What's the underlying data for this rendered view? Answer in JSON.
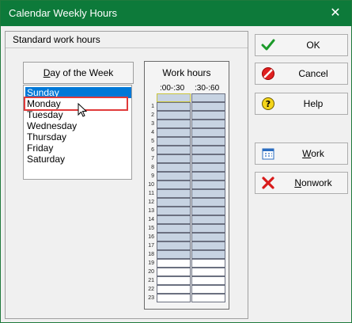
{
  "window": {
    "title": "Calendar Weekly Hours",
    "close_label": "✕"
  },
  "panel": {
    "header": "Standard work hours"
  },
  "days": {
    "header": "Day of the Week",
    "items": [
      "Sunday",
      "Monday",
      "Tuesday",
      "Wednesday",
      "Thursday",
      "Friday",
      "Saturday"
    ],
    "selected": "Sunday",
    "highlighted": "Monday"
  },
  "work_hours": {
    "title": "Work hours",
    "col_a": ":00-:30",
    "col_b": ":30-:60",
    "rows": [
      {
        "hour": "",
        "a": "work",
        "b": "work"
      },
      {
        "hour": "1",
        "a": "work",
        "b": "work"
      },
      {
        "hour": "2",
        "a": "work",
        "b": "work"
      },
      {
        "hour": "3",
        "a": "work",
        "b": "work"
      },
      {
        "hour": "4",
        "a": "work",
        "b": "work"
      },
      {
        "hour": "5",
        "a": "work",
        "b": "work"
      },
      {
        "hour": "6",
        "a": "work",
        "b": "work"
      },
      {
        "hour": "7",
        "a": "work",
        "b": "work"
      },
      {
        "hour": "8",
        "a": "work",
        "b": "work"
      },
      {
        "hour": "9",
        "a": "work",
        "b": "work"
      },
      {
        "hour": "10",
        "a": "work",
        "b": "work"
      },
      {
        "hour": "11",
        "a": "work",
        "b": "work"
      },
      {
        "hour": "12",
        "a": "work",
        "b": "work"
      },
      {
        "hour": "13",
        "a": "work",
        "b": "work"
      },
      {
        "hour": "14",
        "a": "work",
        "b": "work"
      },
      {
        "hour": "15",
        "a": "work",
        "b": "work"
      },
      {
        "hour": "16",
        "a": "work",
        "b": "work"
      },
      {
        "hour": "17",
        "a": "work",
        "b": "work"
      },
      {
        "hour": "18",
        "a": "work",
        "b": "work"
      },
      {
        "hour": "19",
        "a": "non",
        "b": "non"
      },
      {
        "hour": "20",
        "a": "non",
        "b": "non"
      },
      {
        "hour": "21",
        "a": "non",
        "b": "non"
      },
      {
        "hour": "22",
        "a": "non",
        "b": "non"
      },
      {
        "hour": "23",
        "a": "non",
        "b": "non"
      }
    ]
  },
  "buttons": {
    "ok": "OK",
    "cancel": "Cancel",
    "help": "Help",
    "work": "Work",
    "nonwork": "Nonwork"
  },
  "icons": {
    "ok": "check-icon",
    "cancel": "no-entry-icon",
    "help": "question-icon",
    "work": "calendar-icon",
    "nonwork": "x-icon"
  },
  "colors": {
    "titlebar": "#0d7a3a",
    "selection": "#0078d7",
    "work_cell": "#c7d3e2",
    "highlight_box": "#e03a3a"
  }
}
